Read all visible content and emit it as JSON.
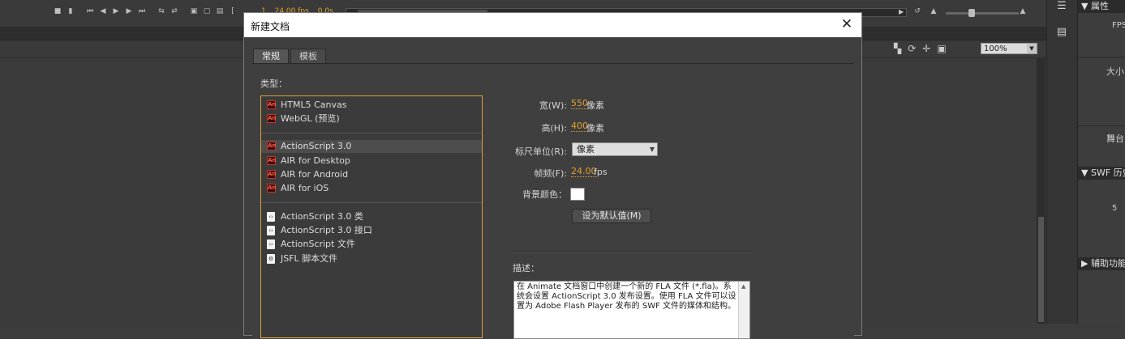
{
  "timeline": {
    "frame_readout": "1",
    "fps_readout": "24.00 fps",
    "time_readout": "0.0s"
  },
  "stage": {
    "zoom": "100%"
  },
  "properties_panel": {
    "header": "属性",
    "fps_label": "FPS",
    "size_label": "大小",
    "stage_label": "舞台",
    "swf_history_header": "SWF 历史",
    "swf_value": "5",
    "accessibility_header": "辅助功能"
  },
  "dialog": {
    "title": "新建文档",
    "tabs": [
      {
        "label": "常规",
        "active": true
      },
      {
        "label": "模板",
        "active": false
      }
    ],
    "type_label": "类型：",
    "groups": [
      {
        "items": [
          {
            "label": "HTML5 Canvas",
            "icon": "animate-doc-icon"
          },
          {
            "label": "WebGL (预览)",
            "icon": "animate-doc-icon"
          }
        ]
      },
      {
        "items": [
          {
            "label": "ActionScript 3.0",
            "icon": "animate-doc-icon",
            "selected": true
          },
          {
            "label": "AIR for Desktop",
            "icon": "animate-doc-icon"
          },
          {
            "label": "AIR for Android",
            "icon": "animate-doc-icon"
          },
          {
            "label": "AIR for iOS",
            "icon": "animate-doc-icon"
          }
        ]
      },
      {
        "items": [
          {
            "label": "ActionScript 3.0 类",
            "icon": "script-file-icon"
          },
          {
            "label": "ActionScript 3.0 接口",
            "icon": "script-file-icon"
          },
          {
            "label": "ActionScript 文件",
            "icon": "script-file-icon"
          },
          {
            "label": "JSFL 脚本文件",
            "icon": "jsfl-file-icon"
          }
        ]
      }
    ],
    "width": {
      "label": "宽(W):",
      "value": "550",
      "unit": "像素"
    },
    "height": {
      "label": "高(H):",
      "value": "400",
      "unit": "像素"
    },
    "ruler_units": {
      "label": "标尺单位(R):",
      "value": "像素"
    },
    "frame_rate": {
      "label": "帧频(F):",
      "value": "24.00",
      "unit": "fps"
    },
    "bg_color": {
      "label": "背景颜色：",
      "value": "#ffffff"
    },
    "default_button": "设为默认值(M)",
    "description_label": "描述：",
    "description_text": "在 Animate 文档窗口中创建一个新的 FLA 文件 (*.fla)。系统会设置 ActionScript 3.0 发布设置。使用 FLA 文件可以设置为 Adobe Flash Player 发布的 SWF 文件的媒体和结构。"
  },
  "colors": {
    "accent": "#e0a030",
    "list_border": "#d9a23a",
    "dialog_bg": "#3f3f3f",
    "app_bg": "#3c3c3c"
  }
}
